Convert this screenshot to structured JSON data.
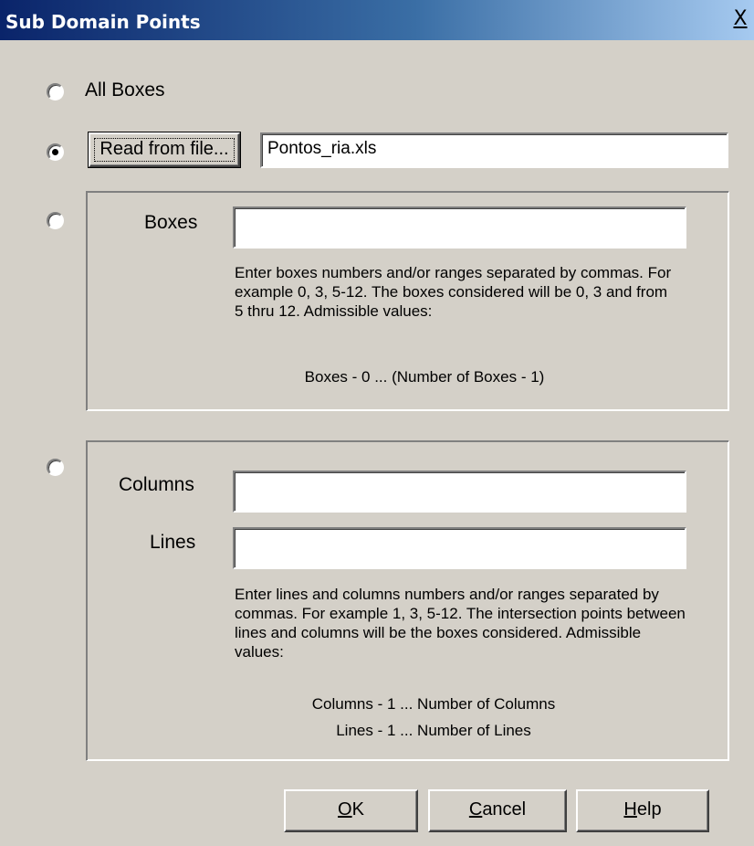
{
  "window": {
    "title": "Sub Domain Points",
    "close_label": "X"
  },
  "options": {
    "all_boxes_label": "All Boxes",
    "read_from_file_button": "Read from file...",
    "file_name_value": "Pontos_ria.xls",
    "selected_option": "read_from_file"
  },
  "boxes_group": {
    "boxes_label": "Boxes",
    "boxes_value": "",
    "hint": "Enter boxes numbers and/or ranges separated by commas. For example 0, 3, 5-12. The boxes considered will be 0, 3 and from 5 thru 12. Admissible values:",
    "admissible": "Boxes - 0 ... (Number of Boxes - 1)"
  },
  "grid_group": {
    "columns_label": "Columns",
    "columns_value": "",
    "lines_label": "Lines",
    "lines_value": "",
    "hint": "Enter lines and columns numbers and/or ranges separated by commas. For example 1, 3, 5-12. The intersection points between lines and columns will be the boxes considered. Admissible values:",
    "admissible_columns": "Columns - 1 ... Number of Columns",
    "admissible_lines": "Lines - 1 ... Number of Lines"
  },
  "buttons": {
    "ok_accel": "O",
    "ok_rest": "K",
    "cancel_accel": "C",
    "cancel_rest": "ancel",
    "help_accel": "H",
    "help_rest": "elp"
  }
}
